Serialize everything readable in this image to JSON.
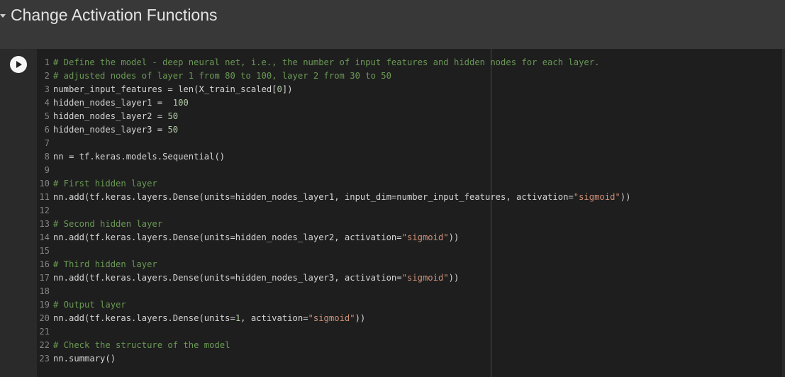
{
  "section": {
    "title": "Change Activation Functions"
  },
  "cell": {
    "run_button": "play-icon",
    "lines": [
      {
        "num": "1",
        "segments": [
          {
            "text": "# Define the model - deep neural net, i.e., the number of input features and hidden nodes for each layer.",
            "kind": "comment"
          }
        ]
      },
      {
        "num": "2",
        "segments": [
          {
            "text": "# adjusted nodes of layer 1 from 80 to 100, layer 2 from 30 to 50",
            "kind": "comment"
          }
        ]
      },
      {
        "num": "3",
        "segments": [
          {
            "text": "number_input_features = len(X_train_scaled[",
            "kind": "code"
          },
          {
            "text": "0",
            "kind": "num"
          },
          {
            "text": "])",
            "kind": "code"
          }
        ]
      },
      {
        "num": "4",
        "segments": [
          {
            "text": "hidden_nodes_layer1 =  ",
            "kind": "code"
          },
          {
            "text": "100",
            "kind": "num"
          }
        ]
      },
      {
        "num": "5",
        "segments": [
          {
            "text": "hidden_nodes_layer2 = ",
            "kind": "code"
          },
          {
            "text": "50",
            "kind": "num"
          }
        ]
      },
      {
        "num": "6",
        "segments": [
          {
            "text": "hidden_nodes_layer3 = ",
            "kind": "code"
          },
          {
            "text": "50",
            "kind": "num"
          }
        ]
      },
      {
        "num": "7",
        "segments": []
      },
      {
        "num": "8",
        "segments": [
          {
            "text": "nn = tf.keras.models.Sequential()",
            "kind": "code"
          }
        ]
      },
      {
        "num": "9",
        "segments": []
      },
      {
        "num": "10",
        "segments": [
          {
            "text": "# First hidden layer",
            "kind": "comment"
          }
        ]
      },
      {
        "num": "11",
        "segments": [
          {
            "text": "nn.add(tf.keras.layers.Dense(units=hidden_nodes_layer1, input_dim=number_input_features, activation=",
            "kind": "code"
          },
          {
            "text": "\"sigmoid\"",
            "kind": "str"
          },
          {
            "text": "))",
            "kind": "code"
          }
        ]
      },
      {
        "num": "12",
        "segments": []
      },
      {
        "num": "13",
        "segments": [
          {
            "text": "# Second hidden layer",
            "kind": "comment"
          }
        ]
      },
      {
        "num": "14",
        "segments": [
          {
            "text": "nn.add(tf.keras.layers.Dense(units=hidden_nodes_layer2, activation=",
            "kind": "code"
          },
          {
            "text": "\"sigmoid\"",
            "kind": "str"
          },
          {
            "text": "))",
            "kind": "code"
          }
        ]
      },
      {
        "num": "15",
        "segments": []
      },
      {
        "num": "16",
        "segments": [
          {
            "text": "# Third hidden layer",
            "kind": "comment"
          }
        ]
      },
      {
        "num": "17",
        "segments": [
          {
            "text": "nn.add(tf.keras.layers.Dense(units=hidden_nodes_layer3, activation=",
            "kind": "code"
          },
          {
            "text": "\"sigmoid\"",
            "kind": "str"
          },
          {
            "text": "))",
            "kind": "code"
          }
        ]
      },
      {
        "num": "18",
        "segments": []
      },
      {
        "num": "19",
        "segments": [
          {
            "text": "# Output layer",
            "kind": "comment"
          }
        ]
      },
      {
        "num": "20",
        "segments": [
          {
            "text": "nn.add(tf.keras.layers.Dense(units=",
            "kind": "code"
          },
          {
            "text": "1",
            "kind": "num"
          },
          {
            "text": ", activation=",
            "kind": "code"
          },
          {
            "text": "\"sigmoid\"",
            "kind": "str"
          },
          {
            "text": "))",
            "kind": "code"
          }
        ]
      },
      {
        "num": "21",
        "segments": []
      },
      {
        "num": "22",
        "segments": [
          {
            "text": "# Check the structure of the model",
            "kind": "comment"
          }
        ]
      },
      {
        "num": "23",
        "segments": [
          {
            "text": "nn.summary()",
            "kind": "code"
          }
        ]
      }
    ]
  },
  "colors": {
    "comment": "#6a9955",
    "string": "#ce9178",
    "number": "#b5cea8",
    "code": "#d4d4d4",
    "background": "#1e1e1e"
  }
}
